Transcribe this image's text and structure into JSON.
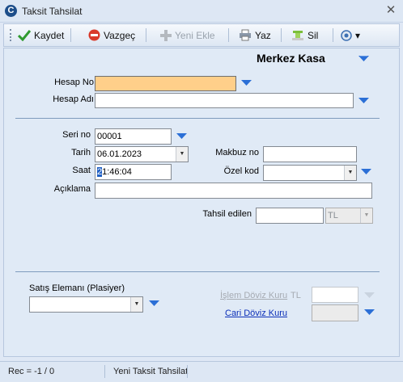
{
  "window": {
    "title": "Taksit Tahsilat",
    "close_glyph": "✕",
    "app_icon": "C"
  },
  "toolbar": {
    "save_label": "Kaydet",
    "cancel_label": "Vazgeç",
    "new_label": "Yeni Ekle",
    "print_label": "Yaz",
    "delete_label": "Sil",
    "dropdown_glyph": "▾"
  },
  "header": {
    "kasa_title": "Merkez Kasa"
  },
  "form": {
    "hesap_no_label": "Hesap No",
    "hesap_no_value": "",
    "hesap_adi_label": "Hesap Adı",
    "hesap_adi_value": "",
    "seri_no_label": "Seri no",
    "seri_no_value": "00001",
    "tarih_label": "Tarih",
    "tarih_value": "06.01.2023",
    "saat_label": "Saat",
    "saat_cursor_char": "2",
    "saat_value_rest": "1:46:04",
    "makbuz_no_label": "Makbuz no",
    "makbuz_no_value": "",
    "ozel_kod_label": "Özel kod",
    "ozel_kod_value": "",
    "aciklama_label": "Açıklama",
    "aciklama_value": "",
    "tahsil_edilen_label": "Tahsil edilen",
    "tahsil_edilen_value": "",
    "currency_value": "TL"
  },
  "bottom": {
    "satis_elemani_label": "Satış Elemanı (Plasiyer)",
    "satis_elemani_value": "",
    "islem_doviz_label": "İşlem Döviz Kuru",
    "islem_doviz_currency": "TL",
    "islem_doviz_value": "",
    "cari_doviz_label": "Cari Döviz Kuru",
    "cari_doviz_value": ""
  },
  "status": {
    "rec_text": "Rec = -1 / 0",
    "mode_text": "Yeni Taksit Tahsilat"
  },
  "colors": {
    "accent_blue": "#2b6fd6",
    "hesap_no_fill": "#ffcf8a"
  }
}
